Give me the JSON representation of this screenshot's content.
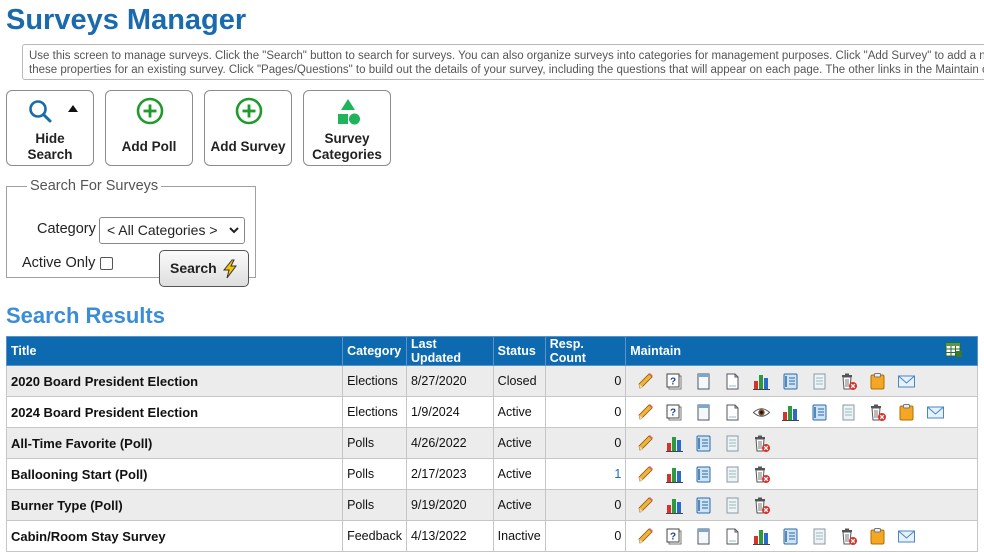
{
  "page_title": "Surveys Manager",
  "info_lines": [
    "Use this screen to manage surveys. Click the \"Search\" button to search for surveys. You can also organize surveys into categories for management purposes. Click \"Add Survey\" to add a new survey",
    "these properties for an existing survey. Click \"Pages/Questions\" to build out the details of your survey, including the questions that will appear on each page. The other links in the Maintain column"
  ],
  "toolbar": {
    "hide_search": "Hide\nSearch",
    "add_poll": "Add Poll",
    "add_survey": "Add Survey",
    "categories": "Survey\nCategories"
  },
  "search": {
    "legend": "Search For Surveys",
    "category_label": "Category",
    "category_value": "< All Categories >",
    "active_label": "Active Only",
    "button": "Search"
  },
  "results_title": "Search Results",
  "columns": [
    "Title",
    "Category",
    "Last Updated",
    "Status",
    "Resp. Count",
    "Maintain"
  ],
  "rows": [
    {
      "title": "2020 Board President Election",
      "category": "Elections",
      "updated": "8/27/2020",
      "status": "Closed",
      "count": "0",
      "icons": [
        "edit-icon",
        "pages-questions-icon",
        "page-icon",
        "document-icon",
        "results-chart-icon",
        "notebook-icon",
        "report-icon",
        "delete-icon",
        "clipboard-icon",
        "email-icon"
      ]
    },
    {
      "title": "2024 Board President Election",
      "category": "Elections",
      "updated": "1/9/2024",
      "status": "Active",
      "count": "0",
      "icons": [
        "edit-icon",
        "pages-questions-icon",
        "page-icon",
        "document-icon",
        "preview-eye-icon",
        "results-chart-icon",
        "notebook-icon",
        "report-icon",
        "delete-icon",
        "clipboard-icon",
        "email-icon"
      ]
    },
    {
      "title": "All-Time Favorite (Poll)",
      "category": "Polls",
      "updated": "4/26/2022",
      "status": "Active",
      "count": "0",
      "icons": [
        "edit-icon",
        "results-chart-icon",
        "notebook-icon",
        "report-icon",
        "delete-icon"
      ]
    },
    {
      "title": "Ballooning Start (Poll)",
      "category": "Polls",
      "updated": "2/17/2023",
      "status": "Active",
      "count": "1",
      "icons": [
        "edit-icon",
        "results-chart-icon",
        "notebook-icon",
        "report-icon",
        "delete-icon"
      ]
    },
    {
      "title": "Burner Type (Poll)",
      "category": "Polls",
      "updated": "9/19/2020",
      "status": "Active",
      "count": "0",
      "icons": [
        "edit-icon",
        "results-chart-icon",
        "notebook-icon",
        "report-icon",
        "delete-icon"
      ]
    },
    {
      "title": "Cabin/Room Stay Survey",
      "category": "Feedback",
      "updated": "4/13/2022",
      "status": "Inactive",
      "count": "0",
      "icons": [
        "edit-icon",
        "pages-questions-icon",
        "page-icon",
        "document-icon",
        "results-chart-icon",
        "notebook-icon",
        "report-icon",
        "delete-icon",
        "clipboard-icon",
        "email-icon"
      ]
    }
  ]
}
